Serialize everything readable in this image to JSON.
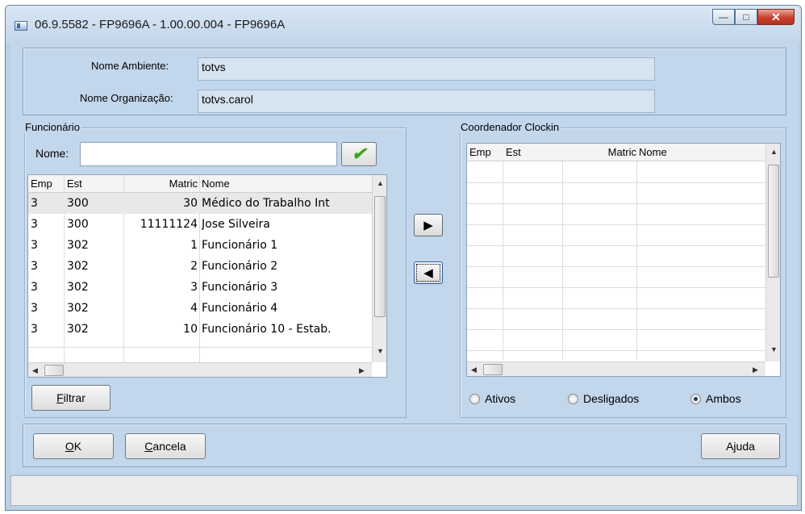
{
  "window": {
    "title": "06.9.5582 - FP9696A - 1.00.00.004 - FP9696A",
    "controls": {
      "minimize": "—",
      "maximize": "□",
      "close": "✕"
    }
  },
  "header": {
    "ambiente_label": "Nome Ambiente:",
    "ambiente_value": "totvs",
    "organizacao_label": "Nome Organização:",
    "organizacao_value": "totvs.carol"
  },
  "funcionario": {
    "legend": "Funcionário",
    "nome_label": "Nome:",
    "nome_value": "",
    "confirm_icon": "✔",
    "columns": [
      "Emp",
      "Est",
      "Matric",
      "Nome"
    ],
    "rows": [
      {
        "emp": "3",
        "est": "300",
        "matric": "30",
        "nome": "Médico do Trabalho Int"
      },
      {
        "emp": "3",
        "est": "300",
        "matric": "11111124",
        "nome": "Jose Silveira"
      },
      {
        "emp": "3",
        "est": "302",
        "matric": "1",
        "nome": "Funcionário 1"
      },
      {
        "emp": "3",
        "est": "302",
        "matric": "2",
        "nome": "Funcionário 2"
      },
      {
        "emp": "3",
        "est": "302",
        "matric": "3",
        "nome": "Funcionário 3"
      },
      {
        "emp": "3",
        "est": "302",
        "matric": "4",
        "nome": "Funcionário 4"
      },
      {
        "emp": "3",
        "est": "302",
        "matric": "10",
        "nome": "Funcionário 10 - Estab."
      }
    ],
    "filtrar_label_u": "F",
    "filtrar_label_rest": "iltrar"
  },
  "transfer": {
    "add_icon": "▶",
    "remove_icon": "◀"
  },
  "coordenador": {
    "legend": "Coordenador Clockin",
    "columns": [
      "Emp",
      "Est",
      "Matric",
      "Nome"
    ],
    "rows": [],
    "filter_options": [
      "Ativos",
      "Desligados",
      "Ambos"
    ],
    "filter_selected": "Ambos"
  },
  "footer": {
    "ok_u": "O",
    "ok_rest": "K",
    "cancela_u": "C",
    "cancela_rest": "ancela",
    "ajuda": "Ajuda"
  },
  "colors": {
    "client_bg": "#c2d6ec",
    "close_red": "#c8402d",
    "check_green": "#3fa51c"
  }
}
